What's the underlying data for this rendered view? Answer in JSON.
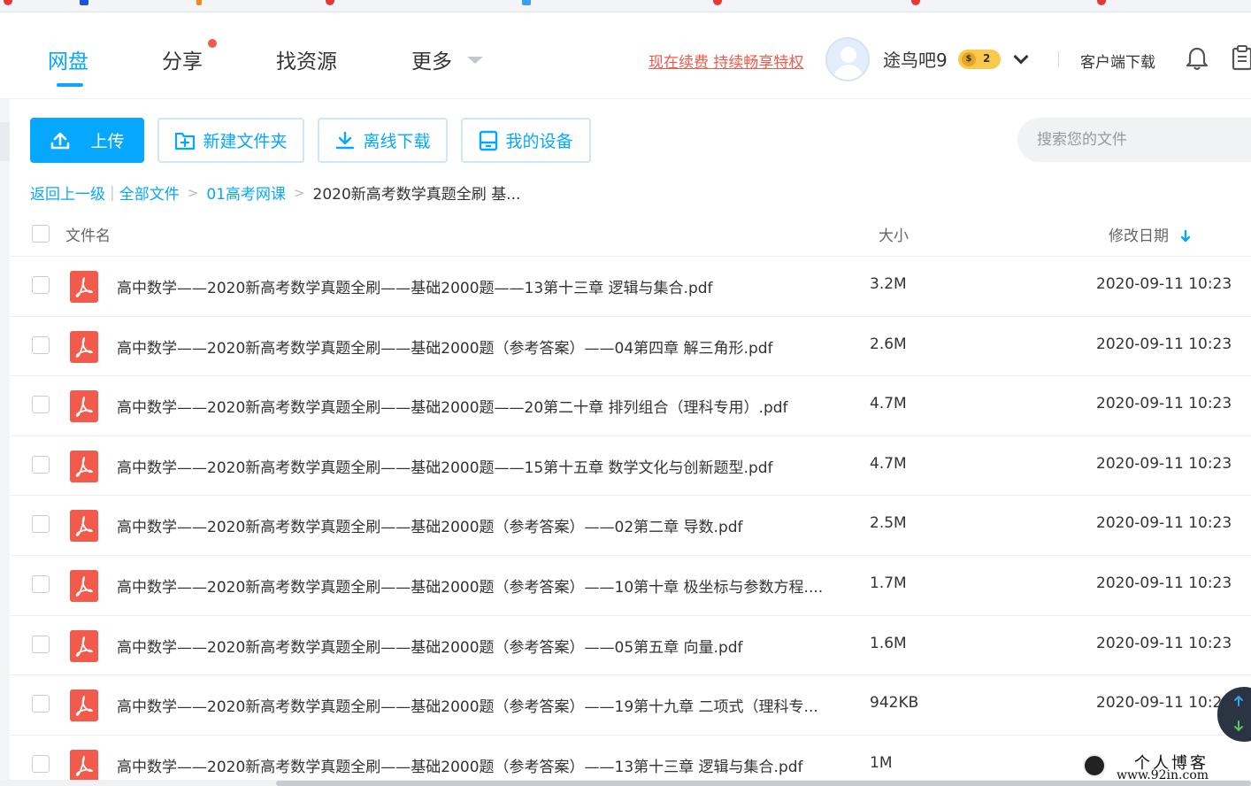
{
  "nav": {
    "items": [
      {
        "label": "网盘",
        "active": true
      },
      {
        "label": "分享",
        "has_dot": true
      },
      {
        "label": "找资源"
      },
      {
        "label": "更多"
      }
    ]
  },
  "header": {
    "promo": "现在续费 持续畅享特权",
    "username": "途鸟吧9",
    "vip_level": "2",
    "client_download": "客户端下载"
  },
  "toolbar": {
    "upload": "上传",
    "new_folder": "新建文件夹",
    "offline_download": "离线下载",
    "my_devices": "我的设备"
  },
  "search": {
    "placeholder": "搜索您的文件"
  },
  "breadcrumb": {
    "back": "返回上一级",
    "all_files": "全部文件",
    "folder": "01高考网课",
    "current": "2020新高考数学真题全刷 基..."
  },
  "table": {
    "columns": {
      "name": "文件名",
      "size": "大小",
      "date": "修改日期"
    },
    "rows": [
      {
        "name": "高中数学——2020新高考数学真题全刷——基础2000题——13第十三章 逻辑与集合.pdf",
        "size": "3.2M",
        "date": "2020-09-11 10:23"
      },
      {
        "name": "高中数学——2020新高考数学真题全刷——基础2000题（参考答案）——04第四章 解三角形.pdf",
        "size": "2.6M",
        "date": "2020-09-11 10:23"
      },
      {
        "name": "高中数学——2020新高考数学真题全刷——基础2000题——20第二十章 排列组合（理科专用）.pdf",
        "size": "4.7M",
        "date": "2020-09-11 10:23"
      },
      {
        "name": "高中数学——2020新高考数学真题全刷——基础2000题——15第十五章 数学文化与创新题型.pdf",
        "size": "4.7M",
        "date": "2020-09-11 10:23"
      },
      {
        "name": "高中数学——2020新高考数学真题全刷——基础2000题（参考答案）——02第二章 导数.pdf",
        "size": "2.5M",
        "date": "2020-09-11 10:23"
      },
      {
        "name": "高中数学——2020新高考数学真题全刷——基础2000题（参考答案）——10第十章 极坐标与参数方程....",
        "size": "1.7M",
        "date": "2020-09-11 10:23"
      },
      {
        "name": "高中数学——2020新高考数学真题全刷——基础2000题（参考答案）——05第五章 向量.pdf",
        "size": "1.6M",
        "date": "2020-09-11 10:23"
      },
      {
        "name": "高中数学——2020新高考数学真题全刷——基础2000题（参考答案）——19第十九章 二项式（理科专...",
        "size": "942KB",
        "date": "2020-09-11 10:23"
      },
      {
        "name": "高中数学——2020新高考数学真题全刷——基础2000题（参考答案）——13第十三章 逻辑与集合.pdf",
        "size": "1M",
        "date": ""
      }
    ]
  },
  "watermark": {
    "title": "个人博客",
    "url": "www.92in.com"
  },
  "colors": {
    "accent": "#06a7ff",
    "pdf_red": "#f25a4b",
    "promo_red": "#f25a4b"
  }
}
